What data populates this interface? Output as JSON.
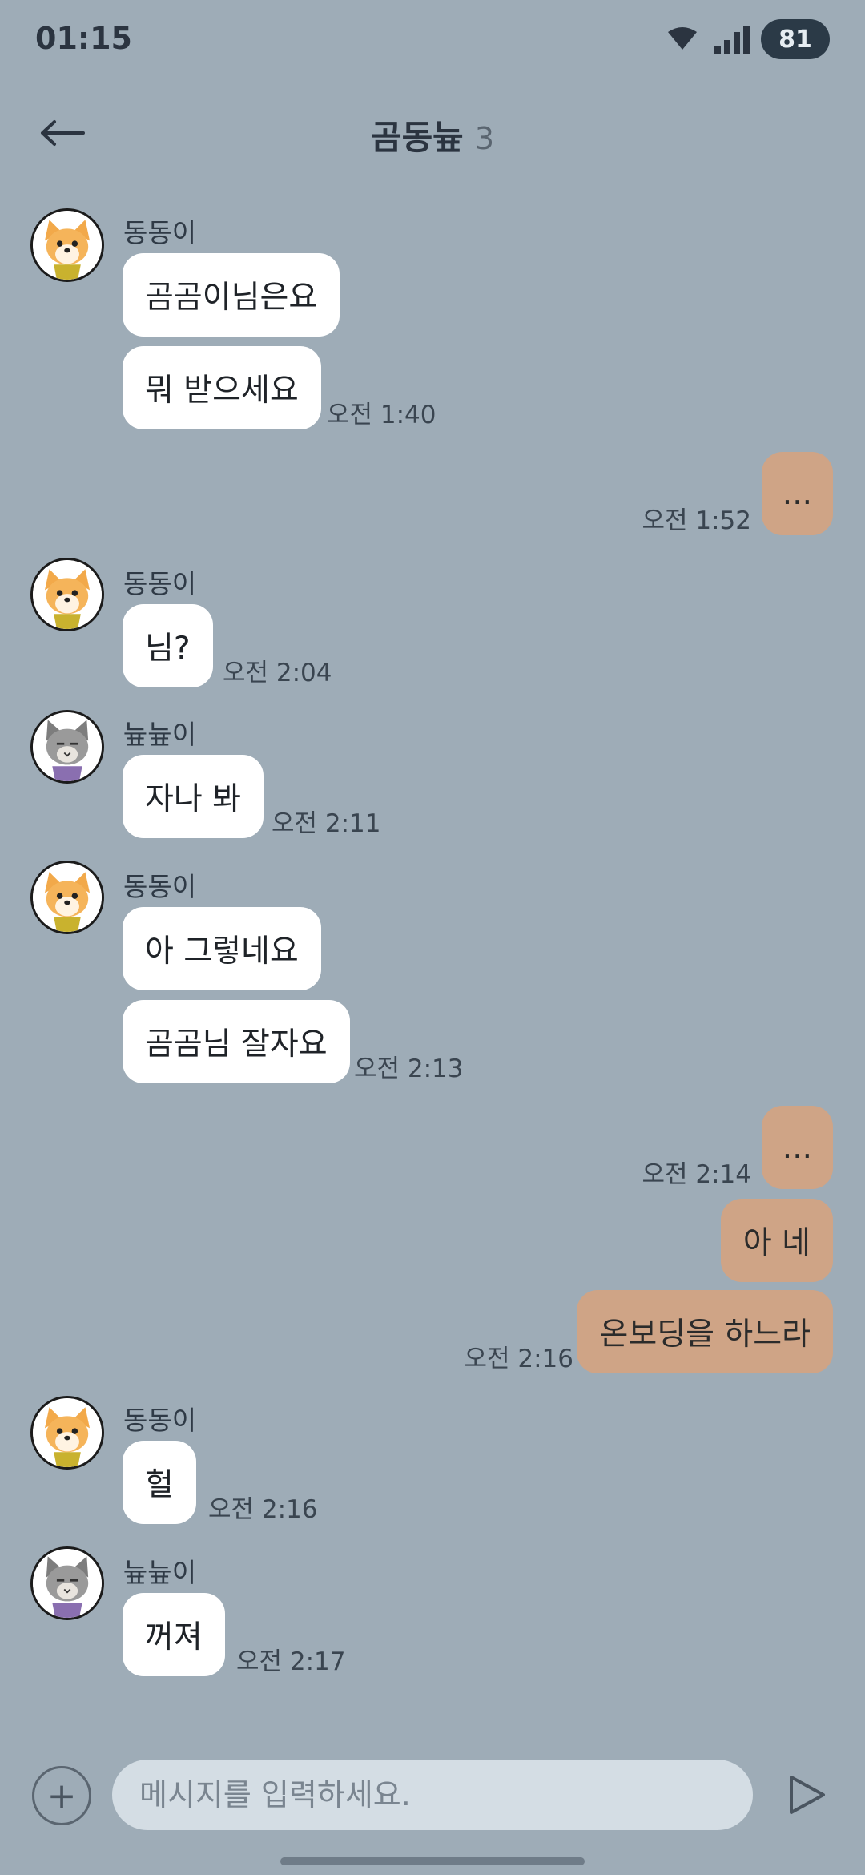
{
  "status": {
    "time": "01:15",
    "battery": "81"
  },
  "header": {
    "title": "곰동늎",
    "member_count": "3"
  },
  "messages": [
    {
      "sender": "동동이",
      "lines": [
        "곰곰이님은요",
        "뭐 받으세요"
      ],
      "time": "오전 1:40"
    },
    {
      "mine": true,
      "lines": [
        "..."
      ],
      "time": "오전 1:52"
    },
    {
      "sender": "동동이",
      "lines": [
        "님?"
      ],
      "time": "오전 2:04"
    },
    {
      "sender": "늎늎이",
      "lines": [
        "자나 봐"
      ],
      "time": "오전 2:11"
    },
    {
      "sender": "동동이",
      "lines": [
        "아 그렇네요",
        "곰곰님 잘자요"
      ],
      "time": "오전 2:13"
    },
    {
      "mine": true,
      "lines": [
        "..."
      ],
      "time": "오전 2:14"
    },
    {
      "mine": true,
      "lines": [
        "아 네",
        "온보딩을 하느라"
      ],
      "time": "오전 2:16"
    },
    {
      "sender": "동동이",
      "lines": [
        "헐"
      ],
      "time": "오전 2:16"
    },
    {
      "sender": "늎늎이",
      "lines": [
        "꺼져"
      ],
      "time": "오전 2:17"
    }
  ],
  "input": {
    "placeholder": "메시지를 입력하세요."
  },
  "icons": {
    "back": "arrow-left-icon",
    "plus": "plus-icon",
    "send": "send-icon",
    "wifi": "wifi-icon",
    "signal": "signal-icon",
    "dog_avatar": "dog-avatar",
    "cat_avatar": "cat-avatar"
  },
  "colors": {
    "background": "#9eacb7",
    "incoming_bubble": "#ffffff",
    "outgoing_bubble": "#cfa486",
    "input_field": "#d4dde4"
  }
}
